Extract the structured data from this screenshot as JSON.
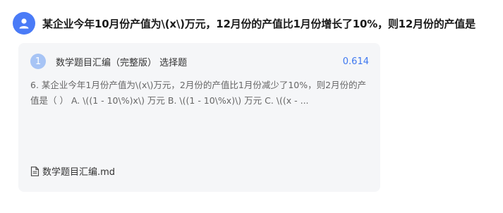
{
  "query": {
    "avatar_icon": "user-icon",
    "text": "某企业今年10月份产值为\\(x\\)万元，12月份的产值比1月份增长了10%，则12月份的产值是"
  },
  "result": {
    "rank": "1",
    "title": "数学题目汇编（完整版） 选择题",
    "score": "0.614",
    "snippet": "6. 某企业今年1月份产值为\\(x\\)万元，2月份的产值比1月份减少了10%，则2月份的产值是（  ） A. \\((1 - 10\\%)x\\) 万元 B. \\((1 - 10\\%x)\\) 万元 C. \\((x - ...",
    "source_icon": "file-icon",
    "source_file": "数学题目汇编.md"
  },
  "colors": {
    "avatar": "#4a7bf7",
    "rank_badge": "#a7c4f5",
    "score": "#3f78f0",
    "card_background": "#f5f6f8"
  }
}
